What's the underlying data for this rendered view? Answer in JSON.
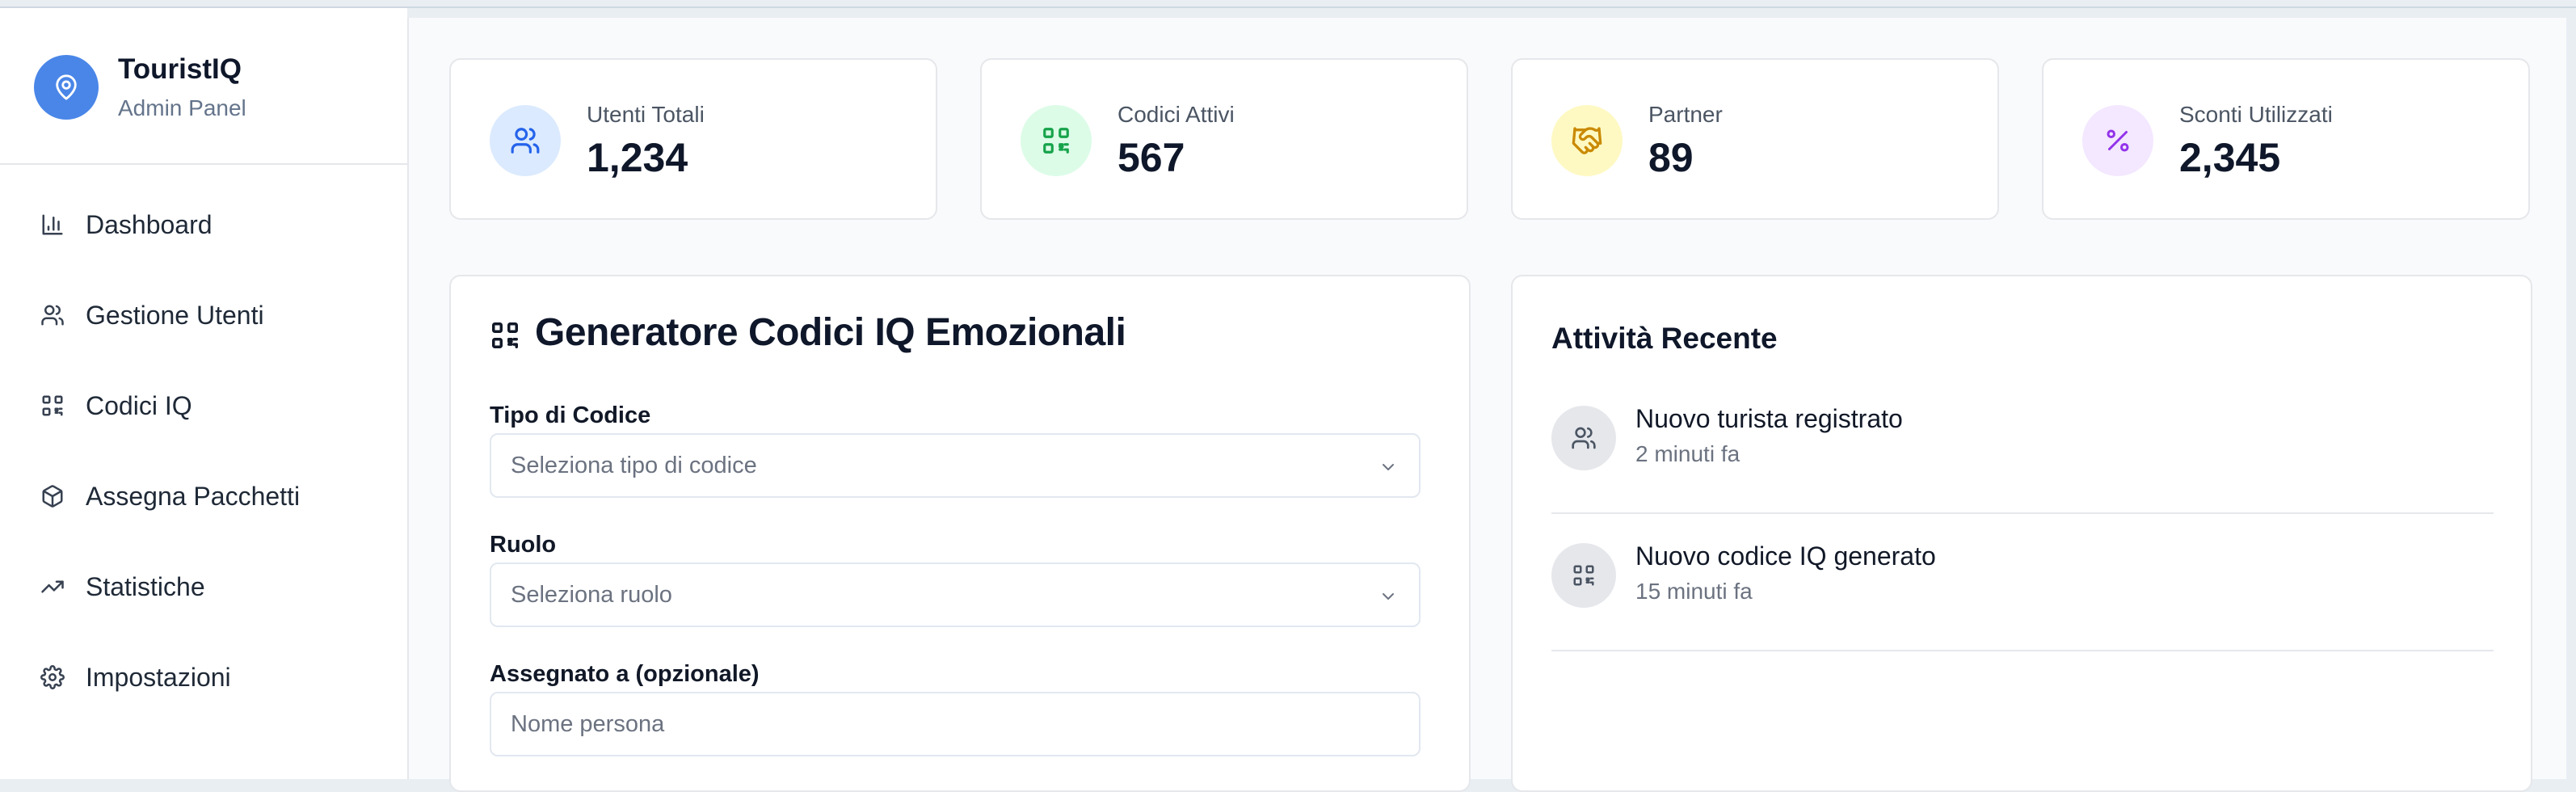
{
  "sidebar": {
    "app_name": "TouristIQ",
    "app_subtitle": "Admin Panel",
    "logo_icon": "map-pin-icon",
    "items": [
      {
        "label": "Dashboard",
        "icon": "bar-chart-icon"
      },
      {
        "label": "Gestione Utenti",
        "icon": "users-icon"
      },
      {
        "label": "Codici IQ",
        "icon": "qr-code-icon"
      },
      {
        "label": "Assegna Pacchetti",
        "icon": "package-icon"
      },
      {
        "label": "Statistiche",
        "icon": "trending-up-icon"
      },
      {
        "label": "Impostazioni",
        "icon": "settings-icon"
      }
    ]
  },
  "stats": [
    {
      "label": "Utenti Totali",
      "value": "1,234",
      "icon": "users-icon",
      "color": "#2563eb",
      "bg": "#dbeafe"
    },
    {
      "label": "Codici Attivi",
      "value": "567",
      "icon": "qr-code-icon",
      "color": "#16a34a",
      "bg": "#dcfce7"
    },
    {
      "label": "Partner",
      "value": "89",
      "icon": "handshake-icon",
      "color": "#ca8a04",
      "bg": "#fef9c3"
    },
    {
      "label": "Sconti Utilizzati",
      "value": "2,345",
      "icon": "percent-icon",
      "color": "#9333ea",
      "bg": "#f3e8ff"
    }
  ],
  "generator": {
    "title": "Generatore Codici IQ Emozionali",
    "icon": "qr-code-icon",
    "code_type_label": "Tipo di Codice",
    "code_type_placeholder": "Seleziona tipo di codice",
    "role_label": "Ruolo",
    "role_placeholder": "Seleziona ruolo",
    "assigned_label": "Assegnato a (opzionale)",
    "assigned_placeholder": "Nome persona"
  },
  "activity": {
    "title": "Attività Recente",
    "items": [
      {
        "text": "Nuovo turista registrato",
        "time": "2 minuti fa",
        "icon": "users-icon"
      },
      {
        "text": "Nuovo codice IQ generato",
        "time": "15 minuti fa",
        "icon": "qr-code-icon"
      }
    ]
  },
  "colors": {
    "accent": "#4a86e8",
    "background": "#f9fafb",
    "border": "#e5e7eb"
  }
}
